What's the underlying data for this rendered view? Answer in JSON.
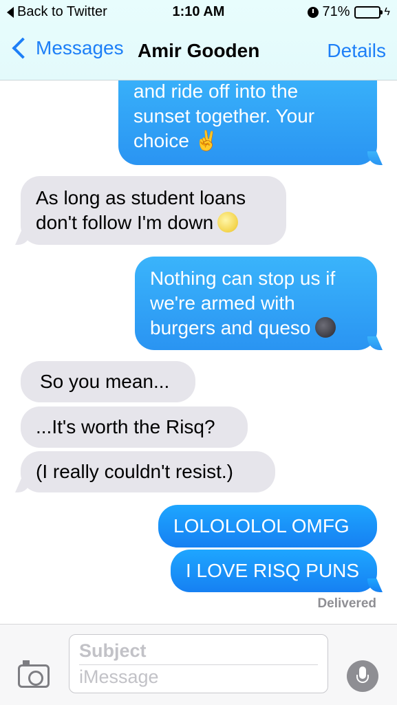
{
  "status_bar": {
    "back_app": "Back to Twitter",
    "time": "1:10 AM",
    "battery": "71%",
    "battery_level": 0.71,
    "icons": [
      "alarm-icon",
      "battery-icon",
      "charging-bolt-icon"
    ]
  },
  "nav": {
    "back_label": "Messages",
    "contact": "Amir Gooden",
    "details_label": "Details"
  },
  "messages": [
    {
      "from": "me",
      "lines": [
        "and ride off into the",
        "sunset together. Your",
        "choice ✌️"
      ]
    },
    {
      "from": "them",
      "lines": [
        "As long as student loans",
        "don't follow I'm down"
      ],
      "emoji": "full-moon-face"
    },
    {
      "from": "me",
      "lines": [
        "Nothing can stop us if",
        "we're armed with",
        "burgers and queso"
      ],
      "emoji": "new-moon-face"
    },
    {
      "from": "them",
      "text": "So you mean..."
    },
    {
      "from": "them",
      "text": "...It's worth the Risq?"
    },
    {
      "from": "them",
      "text": "(I really couldn't resist.)"
    },
    {
      "from": "me",
      "text": "LOLOLOLOL OMFG"
    },
    {
      "from": "me",
      "text": "I LOVE RISQ PUNS"
    }
  ],
  "delivered": "Delivered",
  "composer": {
    "subject_placeholder": "Subject",
    "message_placeholder": "iMessage"
  },
  "colors": {
    "accent": "#1d7ff7",
    "outgoing_bubble": "#1680f2",
    "incoming_bubble": "#e6e5eb"
  }
}
